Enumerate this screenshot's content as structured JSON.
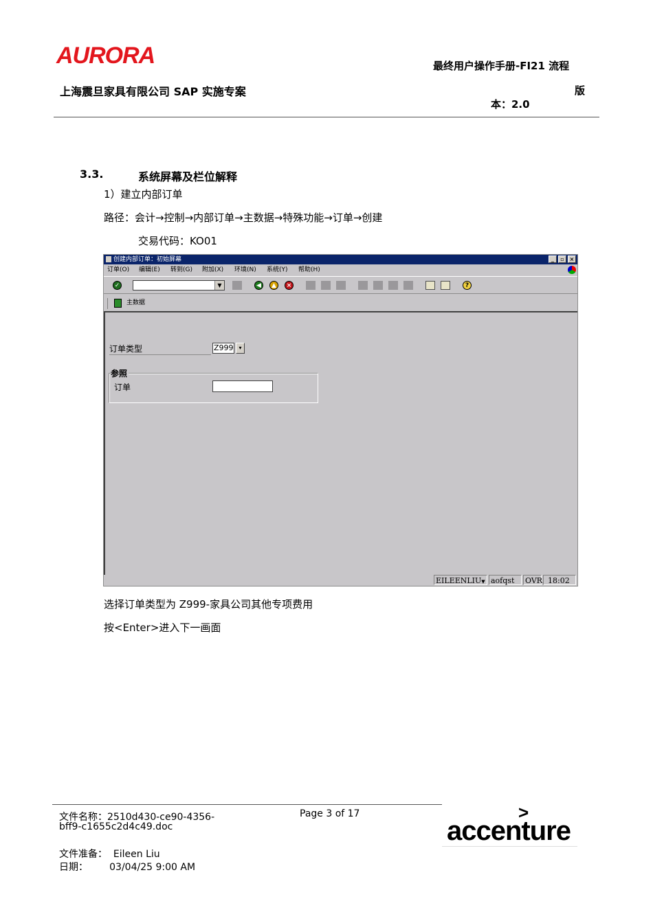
{
  "header": {
    "logo": "AURORA",
    "manual_title": "最终用户操作手册-FI21 流程",
    "company_project": "上海震旦家具有限公司 SAP 实施专案",
    "version_char1": "版",
    "version_rest": "本：2.0"
  },
  "section": {
    "number": "3.3.",
    "title": "系统屏幕及栏位解释",
    "step": "1）建立内部订单",
    "path": "路径：会计→控制→内部订单→主数据→特殊功能→订单→创建",
    "tcode": "交易代码：KO01"
  },
  "sap": {
    "window_title": "创建内部订单：初始屏幕",
    "menu": [
      "订单(O)",
      "编辑(E)",
      "转到(G)",
      "附加(X)",
      "环境(N)",
      "系统(Y)",
      "帮助(H)"
    ],
    "app_toolbar_label": "主数据",
    "order_type_label": "订单类型",
    "order_type_value": "Z999",
    "group_title": "参照",
    "order_label": "订单",
    "order_value": "",
    "status_user": "EILEENLIU",
    "status_server": "aofqst",
    "status_mode": "OVR",
    "status_time": "18:02"
  },
  "notes": {
    "line1": "选择订单类型为 Z999-家具公司其他专项费用",
    "line2": "按<Enter>进入下一画面"
  },
  "footer": {
    "file_name": "文件名称：2510d430-ce90-4356-",
    "file_name_cont": "bff9-c1655c2d4c49.doc",
    "page": "Page 3 of 17",
    "prepared_by": "文件准备：  Eileen Liu",
    "date": "日期：       03/04/25 9:00 AM",
    "brand": "accenture",
    "brand_mark": ">"
  },
  "colors": {
    "logo_red": "#e3161d",
    "sap_bg": "#c8c6c9",
    "titlebar": "#0a246a"
  }
}
